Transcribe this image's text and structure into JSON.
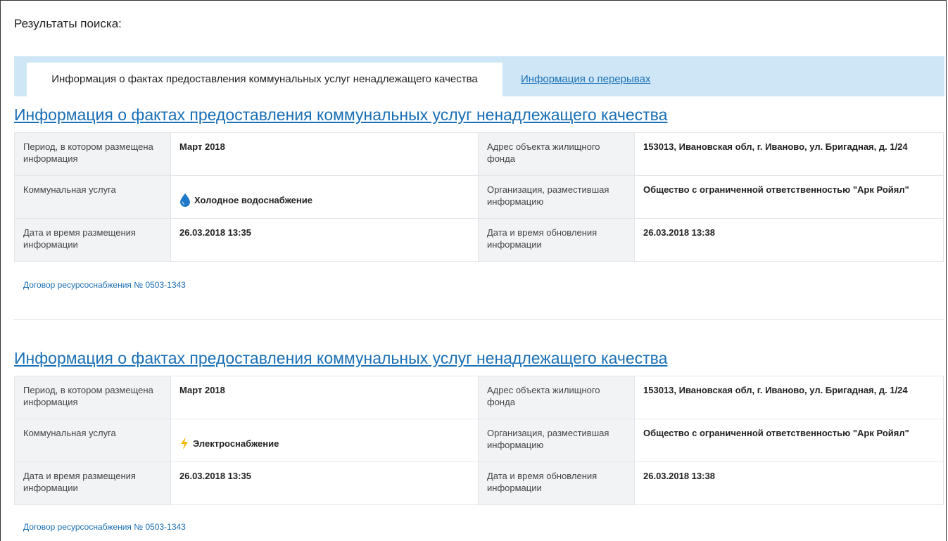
{
  "page": {
    "title": "Результаты поиска:"
  },
  "tabs": [
    {
      "label": "Информация о фактах предоставления коммунальных услуг ненадлежащего качества",
      "active": true
    },
    {
      "label": "Информация о перерывах",
      "active": false
    }
  ],
  "records": [
    {
      "title": "Информация о фактах предоставления коммунальных услуг ненадлежащего качества",
      "period_label": "Период, в котором размещена информация",
      "period_value": "Март 2018",
      "address_label": "Адрес объекта жилищного фонда",
      "address_value": "153013, Ивановская обл, г. Иваново, ул. Бригадная, д. 1/24",
      "service_label": "Коммунальная услуга",
      "service_value": "Холодное водоснабжение",
      "service_icon": "water-drop-icon",
      "org_label": "Организация, разместившая информацию",
      "org_value": "Общество с ограниченной ответственностью \"Арк Ройял\"",
      "placed_label": "Дата и время размещения информации",
      "placed_value": "26.03.2018 13:35",
      "updated_label": "Дата и время обновления информации",
      "updated_value": "26.03.2018 13:38",
      "contract": "Договор ресурсоснабжения № 0503-1343"
    },
    {
      "title": "Информация о фактах предоставления коммунальных услуг ненадлежащего качества",
      "period_label": "Период, в котором размещена информация",
      "period_value": "Март 2018",
      "address_label": "Адрес объекта жилищного фонда",
      "address_value": "153013, Ивановская обл, г. Иваново, ул. Бригадная, д. 1/24",
      "service_label": "Коммунальная услуга",
      "service_value": "Электроснабжение",
      "service_icon": "lightning-icon",
      "org_label": "Организация, разместившая информацию",
      "org_value": "Общество с ограниченной ответственностью \"Арк Ройял\"",
      "placed_label": "Дата и время размещения информации",
      "placed_value": "26.03.2018 13:35",
      "updated_label": "Дата и время обновления информации",
      "updated_value": "26.03.2018 13:38",
      "contract": "Договор ресурсоснабжения № 0503-1343"
    }
  ],
  "colors": {
    "link": "#1a6fb5",
    "tabbar": "#cfe6f7",
    "label_bg": "#f1f3f5",
    "water": "#1f78c8",
    "lightning": "#f5b800"
  }
}
